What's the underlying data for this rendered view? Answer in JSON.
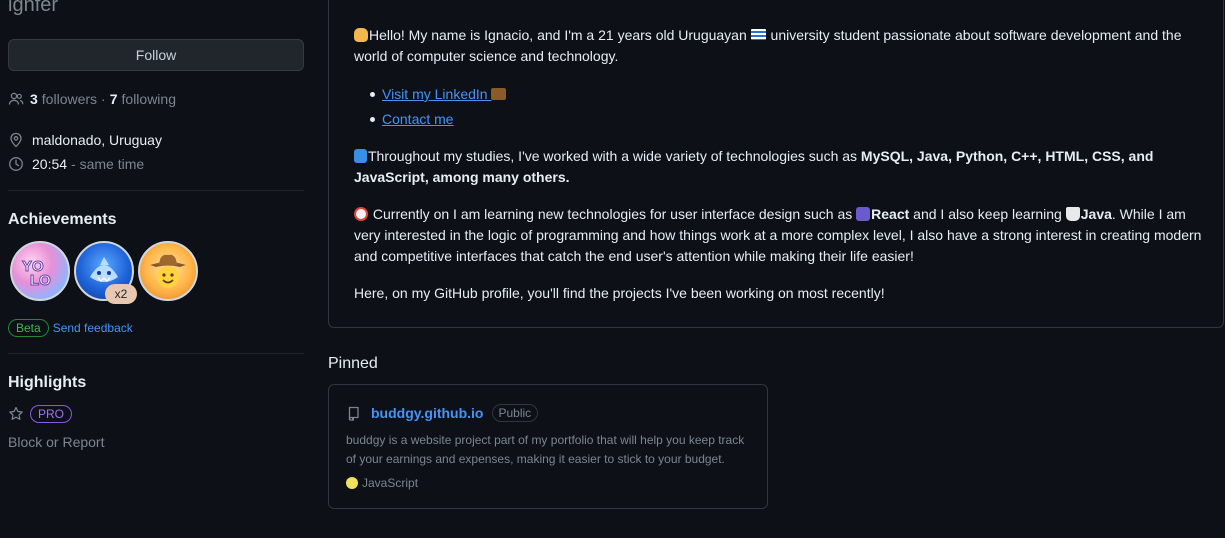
{
  "profile": {
    "username": "ignfer",
    "follow_label": "Follow",
    "followers_count": "3",
    "followers_label": "followers",
    "separator": "·",
    "following_count": "7",
    "following_label": "following",
    "location": "maldonado, Uruguay",
    "local_time": "20:54",
    "time_note": "- same time"
  },
  "achievements": {
    "title": "Achievements",
    "badges": [
      {
        "name": "YOLO",
        "icon": "yolo-badge-icon"
      },
      {
        "name": "Pull Shark",
        "icon": "shark-badge-icon",
        "multiplier": "x2"
      },
      {
        "name": "Starstruck",
        "icon": "cowboy-badge-icon"
      }
    ],
    "beta_label": "Beta",
    "feedback_label": "Send feedback"
  },
  "highlights": {
    "title": "Highlights",
    "pro_label": "PRO",
    "block_label": "Block or Report"
  },
  "readme": {
    "intro_part1": "Hello! My name is Ignacio, and I'm a 21 years old Uruguayan ",
    "intro_part2": " university student passionate about software development and the world of computer science and technology.",
    "links": [
      {
        "label": "Visit my LinkedIn "
      },
      {
        "label": "Contact me"
      }
    ],
    "tech_part1": "Throughout my studies, I've worked with a wide variety of technologies such as ",
    "tech_bold": "MySQL, Java, Python, C++, HTML, CSS, and JavaScript, among many others.",
    "learn_part1": " Currently on I am learning new technologies for user interface design such as ",
    "learn_react": "React",
    "learn_part2": " and I also keep learning ",
    "learn_java": "Java",
    "learn_part3": ". While I am very interested in the logic of programming and how things work at a more complex level, I also have a strong interest in creating modern and competitive interfaces that catch the end user's attention while making their life easier!",
    "outro": "Here, on my GitHub profile, you'll find the projects I've been working on most recently!"
  },
  "pinned": {
    "title": "Pinned",
    "repos": [
      {
        "name": "buddgy.github.io",
        "visibility": "Public",
        "description": "buddgy is a website project part of my portfolio that will help you keep track of your earnings and expenses, making it easier to stick to your budget.",
        "language": "JavaScript",
        "language_color": "#f1e05a"
      }
    ]
  },
  "colors": {
    "background": "#0d1117",
    "link": "#4493f8",
    "muted": "#7d8590",
    "border": "#30363d"
  }
}
